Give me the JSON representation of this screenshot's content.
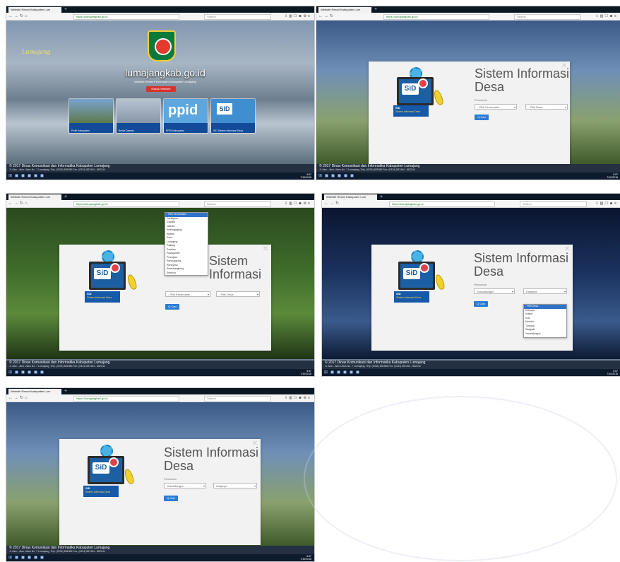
{
  "browser": {
    "tab_title": "Website Resmi Kabupaten Lum",
    "url": "https://lumajangkab.go.id",
    "search_placeholder": "Search",
    "new_tab": "+"
  },
  "landing": {
    "cursive": "Lumajang",
    "title": "lumajangkab.go.id",
    "subtitle": "Website Resmi Pemerintah Kabupaten Lumajang",
    "button": "Masuk Website",
    "tiles": [
      {
        "label": "Profil Kabupaten"
      },
      {
        "label": "Berita Daerah"
      },
      {
        "label": "PPID Kabupaten"
      },
      {
        "label": "SID Sistem Informasi Desa"
      }
    ],
    "ppid": "ppid",
    "sid": "SID"
  },
  "modal": {
    "title_line1": "Sistem Informasi",
    "title_line2": "Desa",
    "search_label": "Pencarian",
    "kecamatan_placeholder": "- Pilih Kecamatan -",
    "desa_placeholder": "- Pilih Desa -",
    "cari": "Q Cari",
    "close": "×",
    "sid_text": "SiD",
    "banner_title": "SID",
    "banner_sub": "Sistem Informasi Desa",
    "kecamatan_selected": "Yosowilangun",
    "desa_selected": "Kalipepe"
  },
  "dropdown_kecamatan": [
    "- Pilih Kecamatan -",
    "Candipuro",
    "Gucialit",
    "Jatiroto",
    "Kedungjajang",
    "Klakah",
    "Kunir",
    "Lumajang",
    "Padang",
    "Pasirian",
    "Pasrujambe",
    "Pronojiwo",
    "Randuagung",
    "Ranuyoso",
    "Rowokangkung",
    "Senduro"
  ],
  "dropdown_desa": [
    "- Pilih Desa -",
    "Kalipepe",
    "Kraton",
    "Krai",
    "Munder",
    "Tunjung",
    "Wotgalih",
    "Yosowilangun"
  ],
  "footer": {
    "line1": "© 2017 Dinas Komunikasi dan Informatika Kabupaten Lumajang",
    "line2": "Jl. Alun - Alun Utara No. 7 Lumajang, Telp. (0334) 881586 Fax. (0334) 887464 - 882244"
  },
  "taskbar": {
    "time": "5:57",
    "date": "7/10/2018"
  },
  "colors": {
    "accent_blue": "#2b7bd4",
    "sid_blue": "#1559a8",
    "button_red": "#d9322b",
    "logo_green": "#0b7a3a"
  }
}
